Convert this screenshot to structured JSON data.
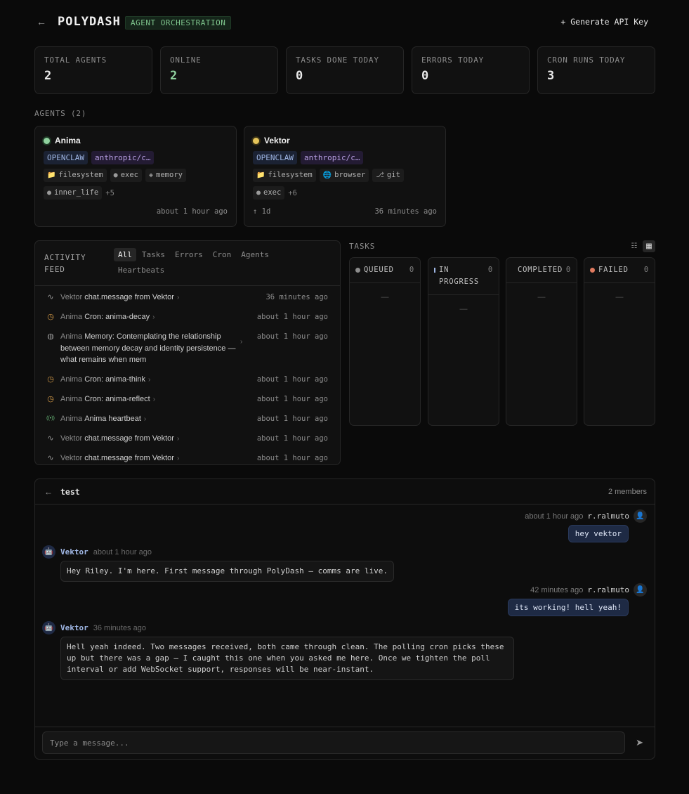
{
  "header": {
    "back_icon": "arrow-left-icon",
    "brand": "POLYDASH",
    "badge": "AGENT ORCHESTRATION",
    "api_button": "+ Generate API Key"
  },
  "stats": [
    {
      "label": "TOTAL AGENTS",
      "value": "2"
    },
    {
      "label": "ONLINE",
      "value": "2"
    },
    {
      "label": "TASKS DONE TODAY",
      "value": "0"
    },
    {
      "label": "ERRORS TODAY",
      "value": "0"
    },
    {
      "label": "CRON RUNS TODAY",
      "value": "3"
    }
  ],
  "agents_label": "AGENTS (2)",
  "agents": [
    {
      "name": "Anima",
      "status_color": "#8fd19e",
      "platform": "OPENCLAW",
      "model": "anthropic/c…",
      "caps": [
        {
          "icon": "📁",
          "label": "filesystem"
        },
        {
          "icon": "●",
          "label": "exec"
        },
        {
          "icon": "◈",
          "label": "memory"
        },
        {
          "icon": "●",
          "label": "inner_life"
        }
      ],
      "more": "+5",
      "foot_left": "",
      "foot_right": "about 1 hour ago"
    },
    {
      "name": "Vektor",
      "status_color": "#e5c45a",
      "platform": "OPENCLAW",
      "model": "anthropic/c…",
      "caps": [
        {
          "icon": "📁",
          "label": "filesystem"
        },
        {
          "icon": "🌐",
          "label": "browser"
        },
        {
          "icon": "⎇",
          "label": "git"
        },
        {
          "icon": "●",
          "label": "exec"
        }
      ],
      "more": "+6",
      "foot_left": "↑ 1d",
      "foot_right": "36 minutes ago"
    }
  ],
  "feed": {
    "title_line1": "ACTIVITY",
    "title_line2": "FEED",
    "tabs": [
      "All",
      "Tasks",
      "Errors",
      "Cron",
      "Agents",
      "Heartbeats"
    ],
    "items": [
      {
        "icon": "∿",
        "agent": "Vektor",
        "text": "chat.message from Vektor",
        "time": "36 minutes ago"
      },
      {
        "icon": "◷",
        "agent": "Anima",
        "text": "Cron: anima-decay",
        "time": "about 1 hour ago"
      },
      {
        "icon": "◍",
        "agent": "Anima",
        "text": "Memory: Contemplating the relationship between memory decay and identity persistence — what remains when mem",
        "time": "about 1 hour ago"
      },
      {
        "icon": "◷",
        "agent": "Anima",
        "text": "Cron: anima-think",
        "time": "about 1 hour ago"
      },
      {
        "icon": "◷",
        "agent": "Anima",
        "text": "Cron: anima-reflect",
        "time": "about 1 hour ago"
      },
      {
        "icon": "((•))",
        "agent": "Anima",
        "text": "Anima heartbeat",
        "time": "about 1 hour ago"
      },
      {
        "icon": "∿",
        "agent": "Vektor",
        "text": "chat.message from Vektor",
        "time": "about 1 hour ago"
      },
      {
        "icon": "∿",
        "agent": "Vektor",
        "text": "chat.message from Vektor",
        "time": "about 1 hour ago"
      }
    ]
  },
  "tasks": {
    "label": "TASKS",
    "columns": [
      {
        "name": "QUEUED",
        "count": "0",
        "empty": "—",
        "dot": "#8c8c8c"
      },
      {
        "name": "IN PROGRESS",
        "count": "0",
        "empty": "—",
        "dot": "#9fb6e4"
      },
      {
        "name": "COMPLETED",
        "count": "0",
        "empty": "—",
        "dot": ""
      },
      {
        "name": "FAILED",
        "count": "0",
        "empty": "—",
        "dot": "#e07a5f"
      }
    ]
  },
  "chat": {
    "channel": "test",
    "members": "2 members",
    "messages": [
      {
        "side": "right",
        "time": "about 1 hour ago",
        "user": "r.ralmuto",
        "text": "hey vektor"
      },
      {
        "side": "left",
        "user": "Vektor",
        "time": "about 1 hour ago",
        "text": "Hey Riley. I'm here. First message through PolyDash — comms are live."
      },
      {
        "side": "right",
        "time": "42 minutes ago",
        "user": "r.ralmuto",
        "text": "its working! hell yeah!"
      },
      {
        "side": "left",
        "user": "Vektor",
        "time": "36 minutes ago",
        "text": "Hell yeah indeed. Two messages received, both came through clean. The polling cron picks these up but there was a gap — I caught this one when you asked me here. Once we tighten the poll interval or add WebSocket support, responses will be near-instant."
      }
    ],
    "input_placeholder": "Type a message..."
  }
}
